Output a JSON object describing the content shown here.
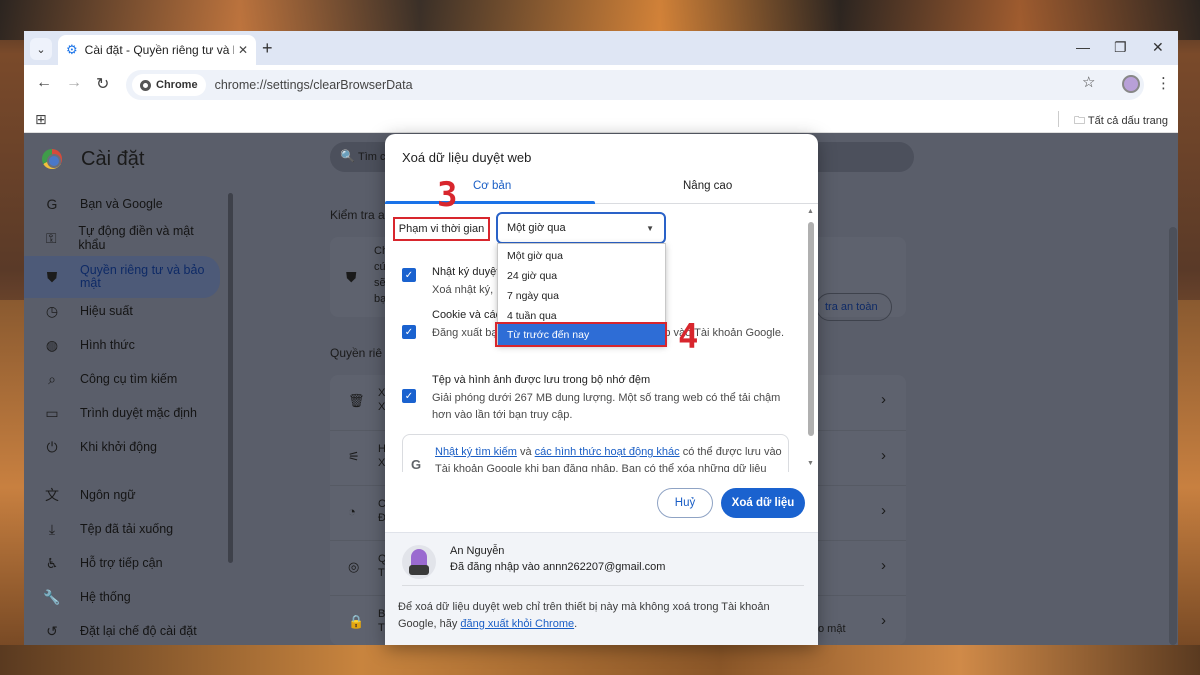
{
  "browser": {
    "tab_title": "Cài đặt - Quyền riêng tư và bảo mật",
    "omnibox_chip": "Chrome",
    "url": "chrome://settings/clearBrowserData",
    "bookmarks_all": "Tất cả dấu trang"
  },
  "settings": {
    "title": "Cài đặt",
    "search_placeholder": "Tìm ch",
    "sidebar": [
      {
        "label": "Bạn và Google",
        "icon": "google-g-icon"
      },
      {
        "label": "Tự động điền và mật khẩu",
        "icon": "key-icon"
      },
      {
        "label": "Quyền riêng tư và bảo mật",
        "icon": "shield-icon",
        "active": true
      },
      {
        "label": "Hiệu suất",
        "icon": "speedometer-icon"
      },
      {
        "label": "Hình thức",
        "icon": "palette-icon"
      },
      {
        "label": "Công cụ tìm kiếm",
        "icon": "search-icon"
      },
      {
        "label": "Trình duyệt mặc định",
        "icon": "browser-window-icon"
      },
      {
        "label": "Khi khởi động",
        "icon": "power-icon"
      },
      {
        "label": "Ngôn ngữ",
        "icon": "translate-icon"
      },
      {
        "label": "Tệp đã tải xuống",
        "icon": "download-icon"
      },
      {
        "label": "Hỗ trợ tiếp cận",
        "icon": "accessibility-icon"
      },
      {
        "label": "Hệ thống",
        "icon": "wrench-icon"
      },
      {
        "label": "Đặt lại chế độ cài đặt",
        "icon": "reset-icon"
      }
    ],
    "safety_section": "Kiểm tra a",
    "safety_button": "tra an toàn",
    "safety_lines": [
      "Ch",
      "cứ",
      "sẽ",
      "bạ"
    ],
    "privacy_section": "Quyền riê",
    "partial_row_text": "o mật"
  },
  "dialog": {
    "title": "Xoá dữ liệu duyệt web",
    "tab_basic": "Cơ bản",
    "tab_advanced": "Nâng cao",
    "time_range_label": "Phạm vi thời gian",
    "time_range_value": "Một giờ qua",
    "options": [
      {
        "title": "Nhật ký duyệt web",
        "desc": "Xoá nhật ký, l",
        "checked": true
      },
      {
        "title": "Cookie và các",
        "desc": "Đăng xuất bạ                             sẽ vẫn duy trì trạng thái đăng nhập vào Tài khoản Google.",
        "checked": true
      },
      {
        "title": "Tệp và hình ảnh được lưu trong bộ nhớ đệm",
        "desc": "Giải phóng dưới 267 MB dung lượng. Một số trang web có thể tải chậm hơn vào lần tới bạn truy cập.",
        "checked": true
      }
    ],
    "info": {
      "link1": "Nhật ký tìm kiếm",
      "and": "và",
      "link2": "các hình thức hoạt động khác",
      "rest": "có thể được lưu vào Tài khoản Google khi bạn đăng nhập. Bạn có thể xóa những dữ liệu này"
    },
    "cancel": "Huỷ",
    "clear": "Xoá dữ liệu",
    "account_name": "An Nguyễn",
    "account_email": "Đã đăng nhập vào annn262207@gmail.com",
    "note_prefix": "Để xoá dữ liệu duyệt web chỉ trên thiết bị này mà không xoá trong Tài khoản Google, hãy",
    "note_link": "đăng xuất khỏi Chrome",
    "note_suffix": "."
  },
  "dropdown": {
    "options": [
      "Một giờ qua",
      "24 giờ qua",
      "7 ngày qua",
      "4 tuần qua",
      "Từ trước đến nay"
    ],
    "selected": "Từ trước đến nay"
  },
  "annotations": {
    "step3": "3",
    "step4": "4"
  },
  "colors": {
    "accent": "#1a73e8",
    "annotation_red": "#d8262d"
  }
}
